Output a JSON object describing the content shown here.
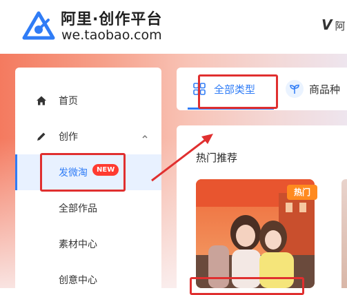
{
  "header": {
    "logo_title": "阿里·创作平台",
    "logo_url": "we.taobao.com",
    "right_mark": "V",
    "right_text": "阿"
  },
  "sidebar": {
    "items": [
      {
        "label": "首页",
        "icon": "home-icon"
      },
      {
        "label": "创作",
        "icon": "pen-icon"
      },
      {
        "label": "发微淘",
        "badge": "NEW",
        "active": true
      },
      {
        "label": "全部作品"
      },
      {
        "label": "素材中心"
      },
      {
        "label": "创意中心"
      }
    ]
  },
  "tabs": [
    {
      "label": "全部类型",
      "icon": "grid-icon",
      "active": true
    },
    {
      "label": "商品种",
      "icon": "sprout-icon"
    }
  ],
  "main": {
    "section_title": "热门推荐",
    "card_tag": "热门"
  },
  "colors": {
    "accent": "#2f7cf6",
    "badge": "#ff3b30",
    "hot_tag": "#ff8a1f",
    "highlight": "#e02f2f"
  }
}
